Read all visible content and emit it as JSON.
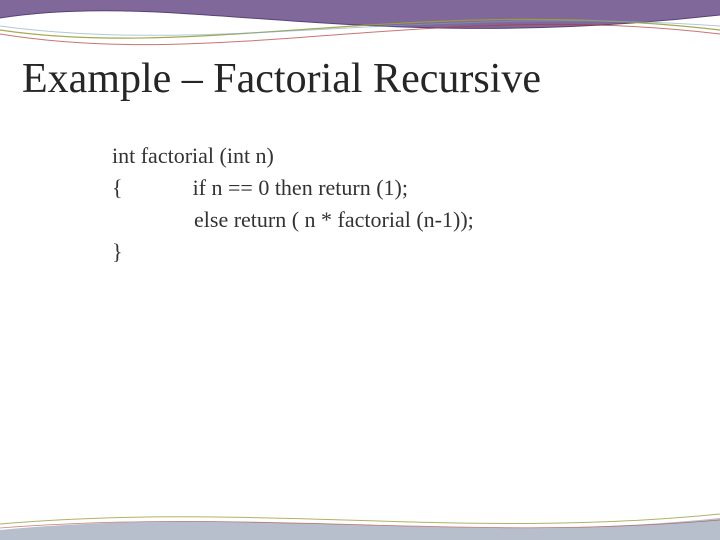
{
  "title": "Example – Factorial Recursive",
  "code": {
    "line1": "int factorial (int n)",
    "brace_open": "{",
    "line2": "if n == 0 then return (1);",
    "line3": "else  return ( n * factorial (n-1));",
    "brace_close": "}"
  }
}
